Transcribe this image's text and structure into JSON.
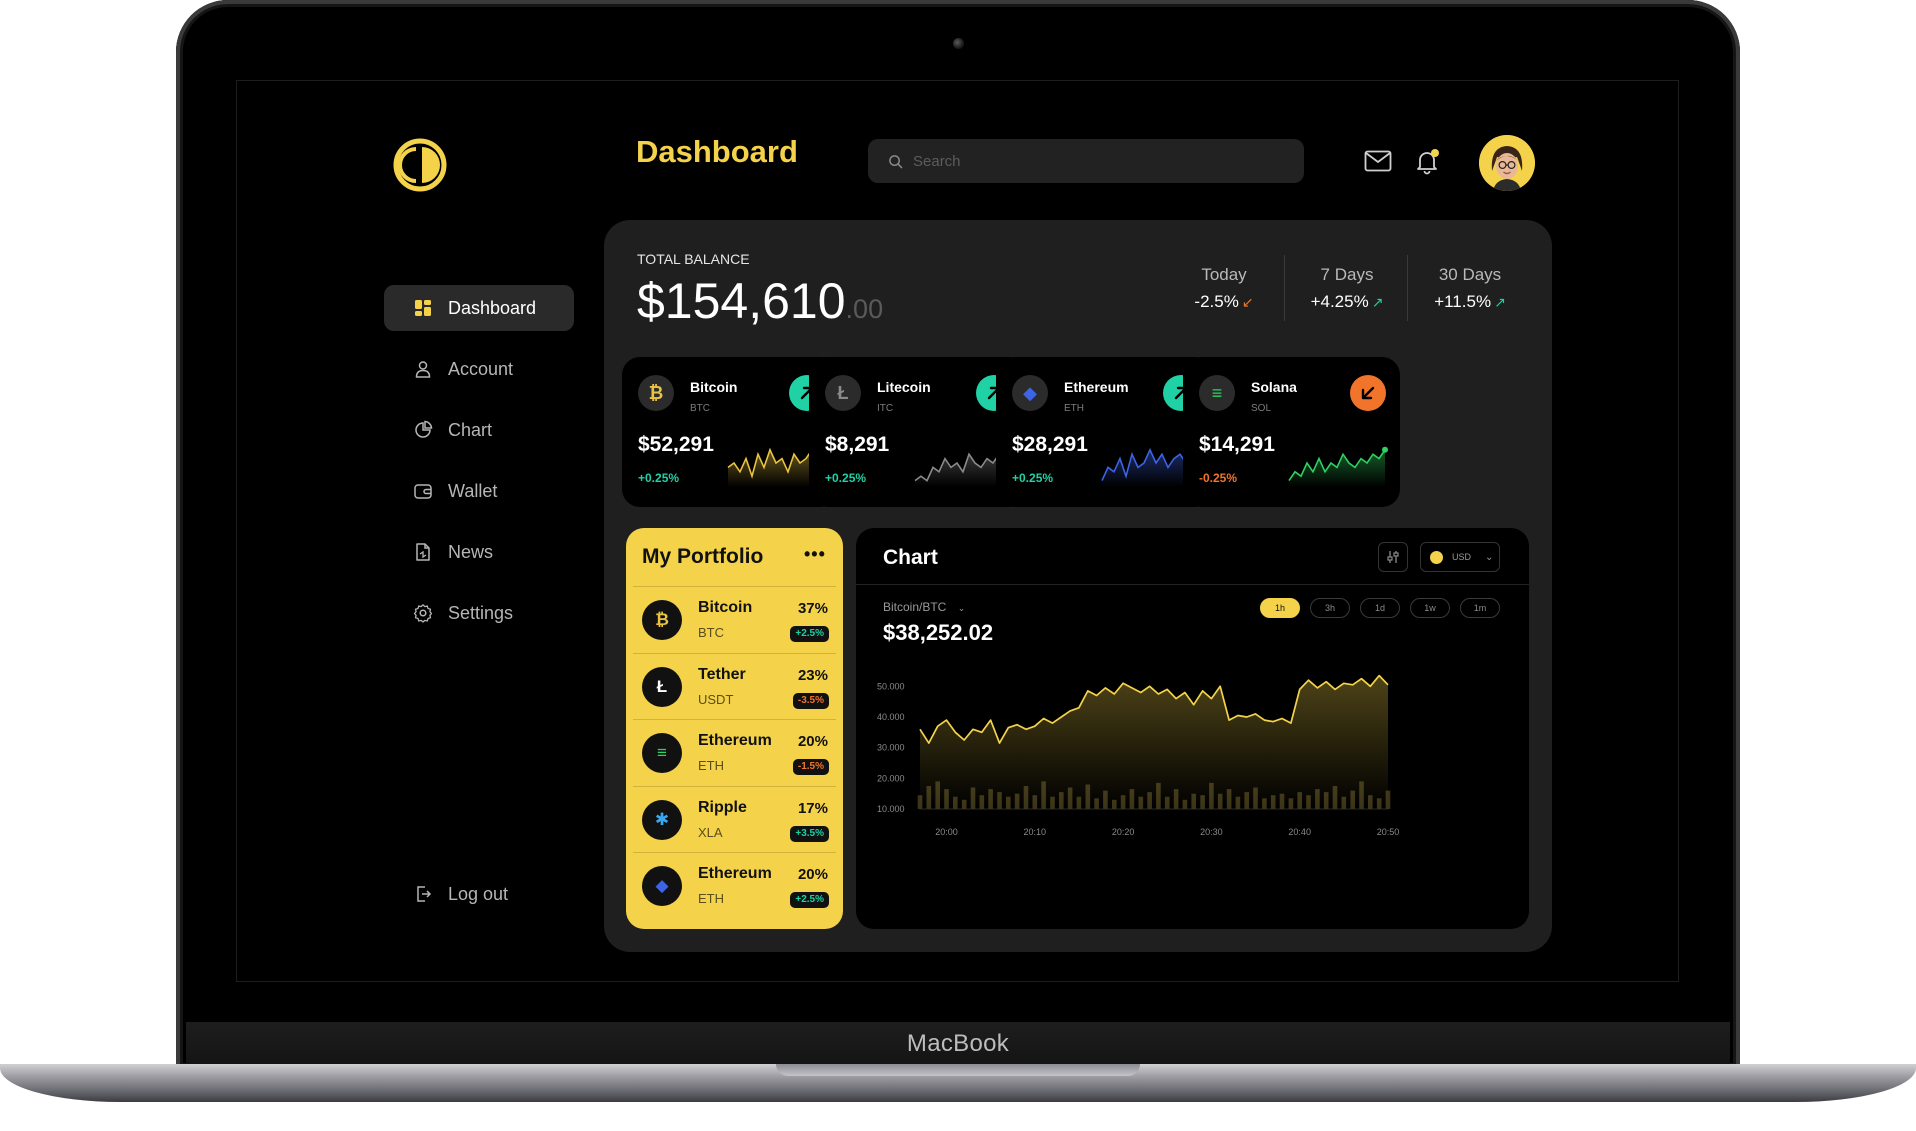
{
  "device": {
    "brand": "MacBook"
  },
  "header": {
    "title": "Dashboard",
    "search_placeholder": "Search"
  },
  "sidebar": {
    "items": [
      {
        "label": "Dashboard",
        "icon": "grid-icon",
        "active": true
      },
      {
        "label": "Account",
        "icon": "user-icon"
      },
      {
        "label": "Chart",
        "icon": "pie-icon"
      },
      {
        "label": "Wallet",
        "icon": "wallet-icon"
      },
      {
        "label": "News",
        "icon": "news-icon"
      },
      {
        "label": "Settings",
        "icon": "gear-icon"
      }
    ],
    "logout_label": "Log out"
  },
  "balance": {
    "label": "TOTAL BALANCE",
    "amount": "$154,610",
    "cents": ".00",
    "periods": [
      {
        "label": "Today",
        "value": "-2.5%",
        "trend": "down"
      },
      {
        "label": "7 Days",
        "value": "+4.25%",
        "trend": "up"
      },
      {
        "label": "30 Days",
        "value": "+11.5%",
        "trend": "up"
      }
    ]
  },
  "coins": [
    {
      "name": "Bitcoin",
      "symbol": "BTC",
      "price": "$52,291",
      "change": "+0.25%",
      "trend": "up",
      "glyph": "₿",
      "color": "#e9c341",
      "spark": [
        6,
        5,
        7,
        4,
        8,
        3,
        6,
        2,
        5,
        4,
        7,
        3,
        5,
        4,
        2,
        5,
        3
      ]
    },
    {
      "name": "Litecoin",
      "symbol": "ITC",
      "price": "$8,291",
      "change": "+0.25%",
      "trend": "up",
      "glyph": "Ł",
      "color": "#8a8a8a",
      "spark": [
        9,
        8,
        9,
        6,
        7,
        4,
        6,
        5,
        7,
        3,
        5,
        6,
        4,
        5,
        3,
        4,
        2
      ]
    },
    {
      "name": "Ethereum",
      "symbol": "ETH",
      "price": "$28,291",
      "change": "+0.25%",
      "trend": "up",
      "glyph": "◆",
      "color": "#3d63e6",
      "spark": [
        9,
        6,
        7,
        4,
        8,
        3,
        6,
        5,
        2,
        5,
        3,
        6,
        4,
        3,
        5,
        4,
        3
      ]
    },
    {
      "name": "Solana",
      "symbol": "SOL",
      "price": "$14,291",
      "change": "-0.25%",
      "trend": "down",
      "glyph": "≡",
      "color": "#2ed260",
      "spark": [
        9,
        7,
        8,
        5,
        7,
        4,
        7,
        5,
        6,
        3,
        5,
        6,
        4,
        5,
        3,
        4,
        2
      ]
    }
  ],
  "colors": {
    "accent": "#f4d34a",
    "up": "#1fd1a5",
    "down": "#f0742a"
  },
  "portfolio": {
    "title": "My Portfolio",
    "items": [
      {
        "name": "Bitcoin",
        "symbol": "BTC",
        "percent": "37%",
        "change": "+2.5%",
        "trend": "up",
        "glyph": "₿",
        "color": "#e9c341"
      },
      {
        "name": "Tether",
        "symbol": "USDT",
        "percent": "23%",
        "change": "-3.5%",
        "trend": "down",
        "glyph": "Ł",
        "color": "#ffffff"
      },
      {
        "name": "Ethereum",
        "symbol": "ETH",
        "percent": "20%",
        "change": "-1.5%",
        "trend": "down",
        "glyph": "≡",
        "color": "#2ed260"
      },
      {
        "name": "Ripple",
        "symbol": "XLA",
        "percent": "17%",
        "change": "+3.5%",
        "trend": "up",
        "glyph": "✱",
        "color": "#3aa8f0"
      },
      {
        "name": "Ethereum",
        "symbol": "ETH",
        "percent": "20%",
        "change": "+2.5%",
        "trend": "up",
        "glyph": "◆",
        "color": "#3d63e6"
      }
    ]
  },
  "chart": {
    "title": "Chart",
    "currency": "USD",
    "pair": "Bitcoin/BTC",
    "price": "$38,252.02",
    "timeframes": [
      {
        "label": "1h",
        "active": true
      },
      {
        "label": "3h"
      },
      {
        "label": "1d"
      },
      {
        "label": "1w"
      },
      {
        "label": "1m"
      }
    ]
  },
  "chart_data": {
    "type": "line",
    "ylim": [
      10000,
      55000
    ],
    "yticks": [
      "50.000",
      "40.000",
      "30.000",
      "20.000",
      "10.000"
    ],
    "ytick_values": [
      50000,
      40000,
      30000,
      20000,
      10000
    ],
    "xticks": [
      "20:00",
      "20:10",
      "20:20",
      "20:30",
      "20:40",
      "20:50"
    ],
    "xtick_values": [
      3,
      13,
      23,
      33,
      43,
      53
    ],
    "series": [
      {
        "values": [
          36000,
          31500,
          37000,
          39000,
          35000,
          32500,
          36000,
          35000,
          39000,
          31500,
          36500,
          37500,
          36000,
          37000,
          39500,
          38000,
          40000,
          42000,
          43000,
          48500,
          47000,
          49500,
          47500,
          51000,
          49500,
          48000,
          50000,
          47500,
          49000,
          46000,
          48000,
          44000,
          48500,
          46000,
          50000,
          39000,
          40500,
          40000,
          41000,
          39000,
          38500,
          39500,
          38000,
          49000,
          52000,
          49500,
          51500,
          49000,
          51000,
          50500,
          52500,
          50000,
          53500,
          50500
        ]
      },
      {
        "type": "bar",
        "values": [
          14500,
          17500,
          19000,
          16500,
          14000,
          13000,
          17000,
          14500,
          16500,
          15500,
          14000,
          15000,
          17500,
          14500,
          19000,
          14000,
          15500,
          17000,
          14000,
          18000,
          13500,
          16000,
          13000,
          14500,
          16500,
          14000,
          15500,
          18500,
          14000,
          16500,
          13000,
          15000,
          14500,
          18500,
          15000,
          16500,
          14000,
          15500,
          17000,
          13500,
          14500,
          15000,
          13500,
          15500,
          14500,
          16500,
          15500,
          17500,
          14000,
          16000,
          19000,
          14500,
          13500,
          16000
        ]
      }
    ]
  }
}
